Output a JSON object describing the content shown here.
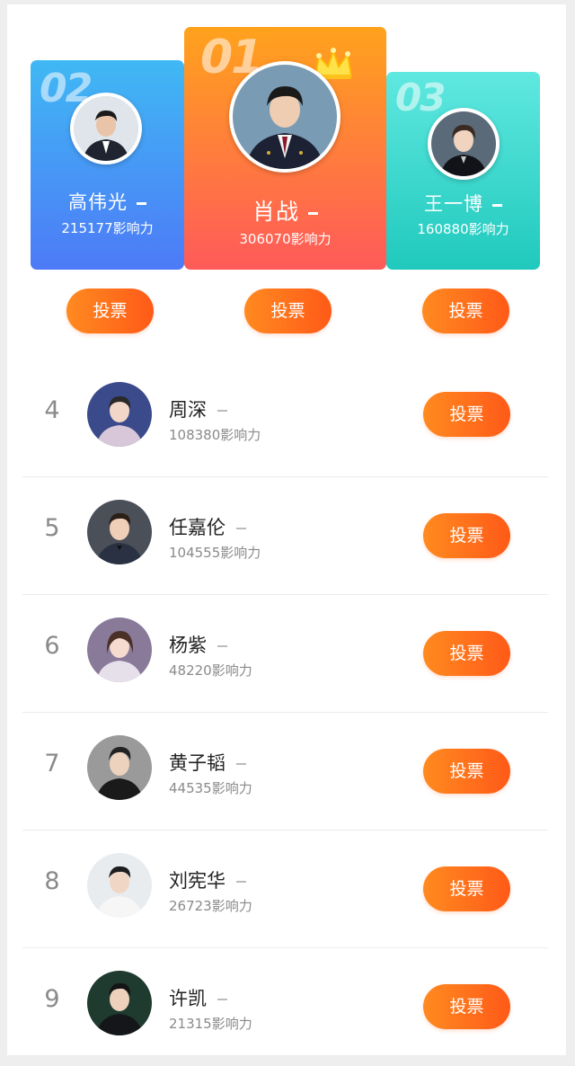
{
  "podium": [
    {
      "rank": "02",
      "name": "高伟光",
      "score": "215177影响力"
    },
    {
      "rank": "01",
      "name": "肖战",
      "score": "306070影响力"
    },
    {
      "rank": "03",
      "name": "王一博",
      "score": "160880影响力"
    }
  ],
  "vote_label": "投票",
  "list": [
    {
      "rank": "4",
      "name": "周深",
      "score": "108380影响力"
    },
    {
      "rank": "5",
      "name": "任嘉伦",
      "score": "104555影响力"
    },
    {
      "rank": "6",
      "name": "杨紫",
      "score": "48220影响力"
    },
    {
      "rank": "7",
      "name": "黄子韬",
      "score": "44535影响力"
    },
    {
      "rank": "8",
      "name": "刘宪华",
      "score": "26723影响力"
    },
    {
      "rank": "9",
      "name": "许凯",
      "score": "21315影响力"
    }
  ],
  "colors": {
    "accent": "#ff6a1c",
    "second_card": "#4d8af7",
    "first_card": "#ff7a2c",
    "third_card": "#2ad4c8"
  }
}
